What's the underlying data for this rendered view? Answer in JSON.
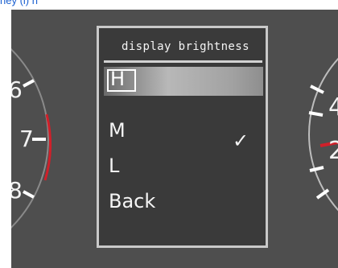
{
  "header_fragment": "ney (l)  n",
  "left_gauge": {
    "labels": [
      "6",
      "7",
      "8"
    ],
    "needle_color": "#d0202a"
  },
  "right_gauge": {
    "labels": [
      "4",
      "2"
    ],
    "needle_color": "#d0202a"
  },
  "menu": {
    "title": "display brightness",
    "items": [
      {
        "label": "H",
        "selected": true
      },
      {
        "label": "M",
        "checked": true
      },
      {
        "label": "L"
      },
      {
        "label": "Back"
      }
    ],
    "check_mark": "✓"
  }
}
